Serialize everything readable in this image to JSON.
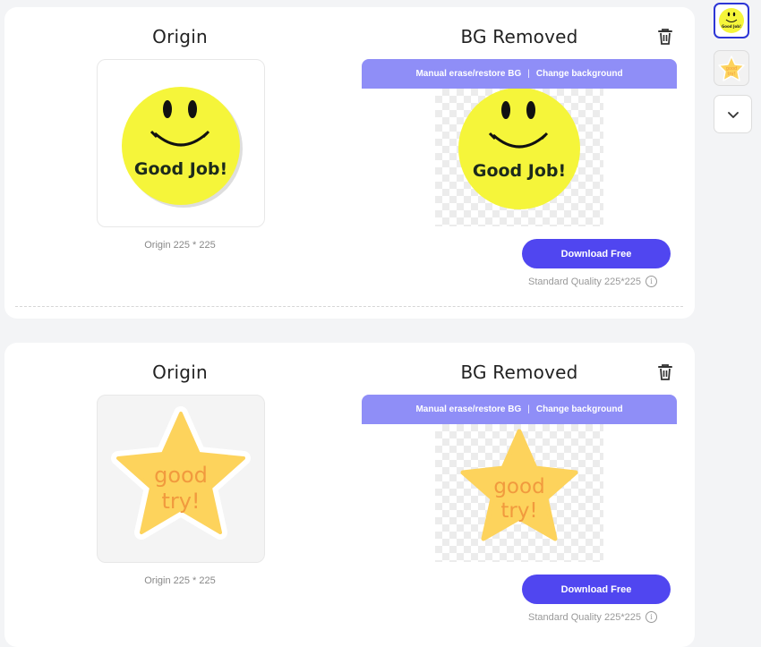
{
  "items": [
    {
      "origin_title": "Origin",
      "removed_title": "BG Removed",
      "toolbar": {
        "erase_label": "Manual erase/restore BG",
        "separator": "|",
        "change_bg_label": "Change background"
      },
      "origin_caption": "Origin 225 * 225",
      "download_label": "Download Free",
      "quality_label": "Standard Quality 225*225",
      "image_text": "Good Job!"
    },
    {
      "origin_title": "Origin",
      "removed_title": "BG Removed",
      "toolbar": {
        "erase_label": "Manual erase/restore BG",
        "separator": "|",
        "change_bg_label": "Change background"
      },
      "origin_caption": "Origin 225 * 225",
      "download_label": "Download Free",
      "quality_label": "Standard Quality 225*225",
      "image_text_line1": "good",
      "image_text_line2": "try!"
    }
  ],
  "sidebar": {
    "thumbnails": [
      {
        "icon": "smiley-sticker-thumbnail",
        "selected": true,
        "image_text": "Good Job!"
      },
      {
        "icon": "star-sticker-thumbnail",
        "selected": false,
        "image_text_line1": "good",
        "image_text_line2": "try!"
      }
    ],
    "expand_icon": "chevron-down-icon"
  },
  "colors": {
    "accent": "#5046f0",
    "toolbar": "#8f8ef7",
    "selected_border": "#2d36d6",
    "smiley_yellow": "#f5f53a",
    "star_yellow": "#fdd35c",
    "star_text": "#f19a3e"
  }
}
